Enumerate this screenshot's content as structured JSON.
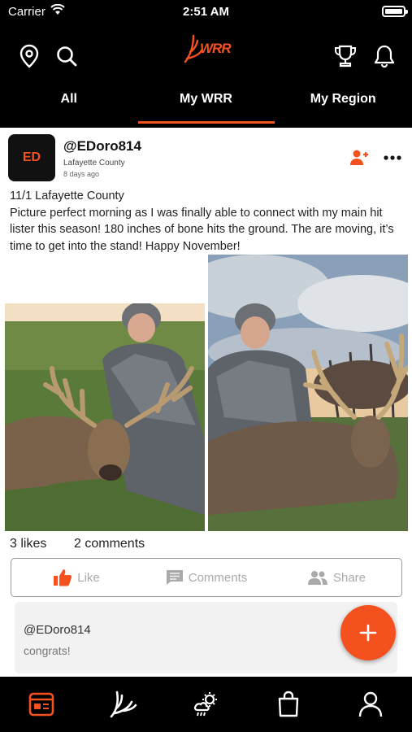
{
  "status_bar": {
    "carrier": "Carrier",
    "time": "2:51 AM"
  },
  "header": {
    "logo_text": "WRR",
    "tabs": [
      {
        "label": "All",
        "active": false
      },
      {
        "label": "My WRR",
        "active": true
      },
      {
        "label": "My Region",
        "active": false
      }
    ]
  },
  "post": {
    "avatar_initials": "ED",
    "username": "@EDoro814",
    "location": "Lafayette County",
    "time_ago": "8 days ago",
    "caption_line1": "11/1 Lafayette County",
    "caption_body": "Picture perfect morning as I was finally able to connect with my main hit lister this season! 180 inches of bone hits the ground. The are moving, it’s time to get into the stand! Happy November!",
    "likes": "3 likes",
    "comments_count": "2 comments",
    "actions": {
      "like": "Like",
      "comments": "Comments",
      "share": "Share"
    }
  },
  "comment": {
    "user": "@EDoro814",
    "text": "congrats!"
  },
  "colors": {
    "accent": "#f4511e",
    "header_bg": "#000000"
  },
  "bottom_nav": [
    "feed-icon",
    "antler-icon",
    "weather-icon",
    "shopping-bag-icon",
    "profile-icon"
  ]
}
